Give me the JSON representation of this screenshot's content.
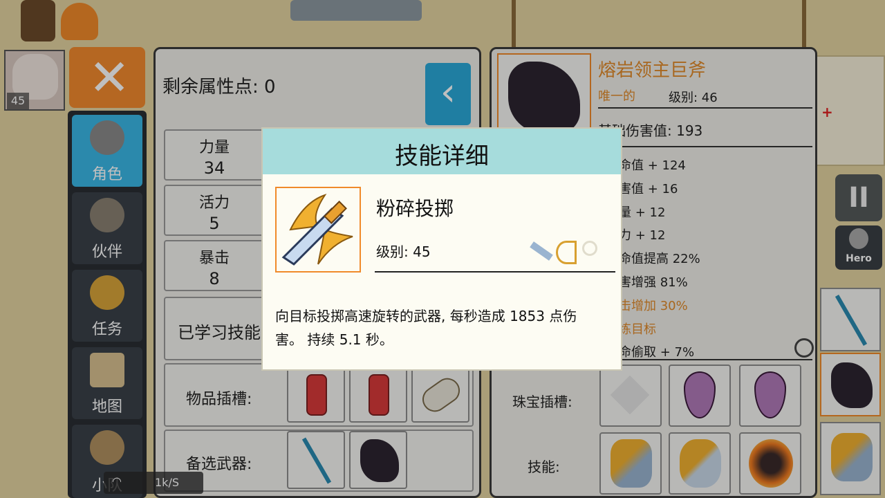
{
  "hero": {
    "level": "45"
  },
  "nav": [
    {
      "label": "角色",
      "icon": "helmet-icon",
      "active": true
    },
    {
      "label": "伙伴",
      "icon": "horned-helmet-icon"
    },
    {
      "label": "任务",
      "icon": "trophy-icon"
    },
    {
      "label": "地图",
      "icon": "map-scroll-icon"
    },
    {
      "label": "小队",
      "icon": "party-icon"
    }
  ],
  "stats_panel": {
    "remaining_points_label": "剩余属性点: 0",
    "stats": [
      {
        "name": "力量",
        "value": "34"
      },
      {
        "name": "活力",
        "value": "5"
      },
      {
        "name": "暴击",
        "value": "8"
      }
    ],
    "learned_skills_label": "已学习技能",
    "item_slots_label": "物品插槽:",
    "alt_weapons_label": "备选武器:"
  },
  "item_panel": {
    "name": "熔岩领主巨斧",
    "rarity": "唯一的",
    "level": "级别: 46",
    "base_damage": "基础伤害值: 193",
    "bonuses": [
      "命值 + 124",
      "害值 + 16",
      "量 + 12",
      "力 + 12",
      "命值提高 22%",
      "害增强 81%",
      "击增加 30%",
      "练目标",
      "命偷取 + 7%"
    ],
    "gem_slots_label": "珠宝插槽:",
    "skills_label": "技能:"
  },
  "hud": {
    "pause": "II",
    "hero_tag": "Hero",
    "net_speed": "1k/S"
  },
  "dialog": {
    "title": "技能详细",
    "skill_name": "粉碎投掷",
    "skill_level": "级别: 45",
    "description": "向目标投掷高速旋转的武器, 每秒造成 1853 点伤害。 持续 5.1 秒。"
  },
  "colors": {
    "accent_blue": "#3ab7e6",
    "close_orange": "#f28a2e",
    "item_name_orange": "#e08a2a",
    "dialog_header": "#a6dcdc",
    "icon_border": "#f08a2a"
  }
}
